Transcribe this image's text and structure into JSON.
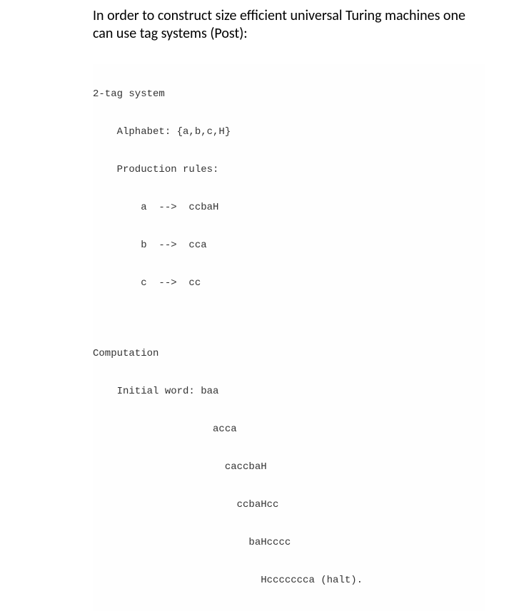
{
  "intro": "In order to construct size efficient universal Turing machines one can use tag systems (Post):",
  "code": {
    "header": "2-tag system",
    "alphabet_label": "    Alphabet: {a,b,c,H}",
    "rules_label": "    Production rules:",
    "rule1": "        a  -->  ccbaH",
    "rule2": "        b  -->  cca",
    "rule3": "        c  -->  cc",
    "comp_label": "Computation",
    "init_label": "    Initial word: baa",
    "step1": "                    acca",
    "step2": "                      caccbaH",
    "step3": "                        ccbaHcc",
    "step4": "                          baHcccc",
    "step5": "                            Hccccccca (halt)."
  }
}
